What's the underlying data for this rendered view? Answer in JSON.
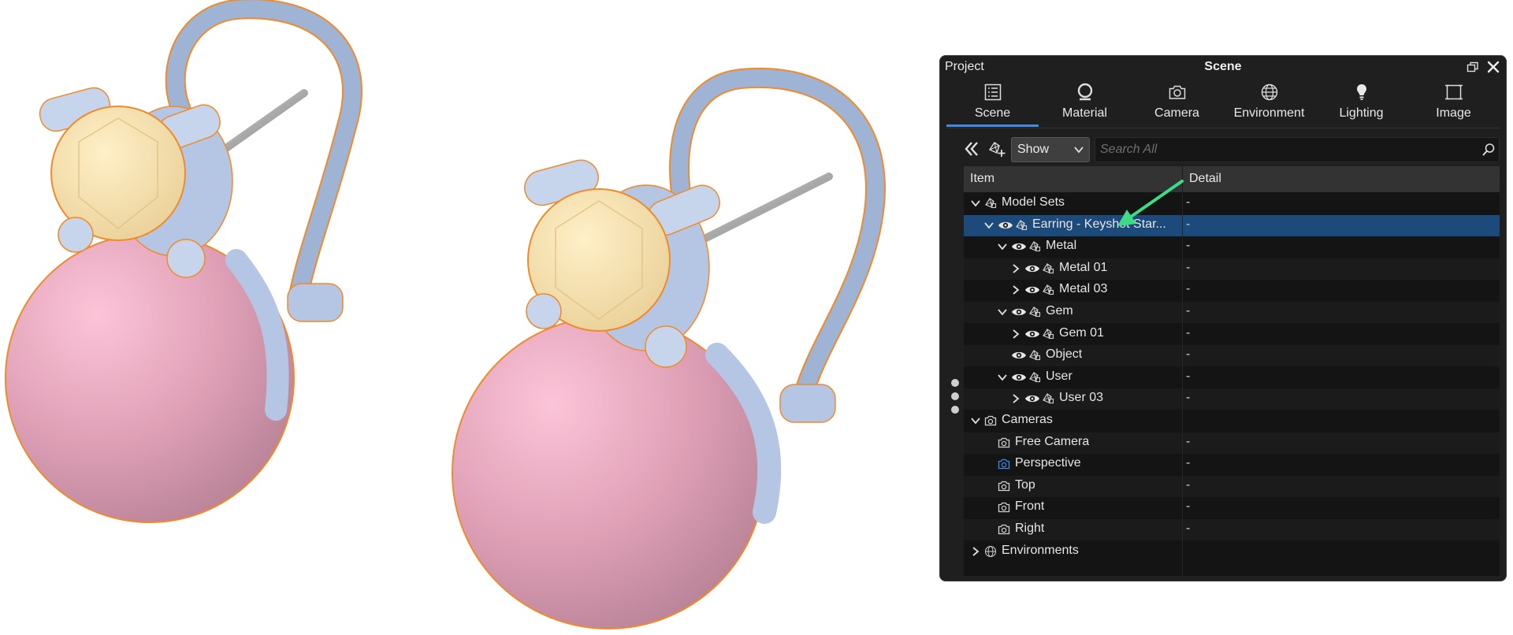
{
  "panel": {
    "project_label": "Project",
    "title": "Scene",
    "tabs": [
      {
        "label": "Scene",
        "icon": "list-icon",
        "active": true
      },
      {
        "label": "Material",
        "icon": "material-sphere-icon"
      },
      {
        "label": "Camera",
        "icon": "camera-icon"
      },
      {
        "label": "Environment",
        "icon": "globe-icon"
      },
      {
        "label": "Lighting",
        "icon": "lightbulb-icon"
      },
      {
        "label": "Image",
        "icon": "image-frame-icon"
      }
    ],
    "toolbar": {
      "filter_value": "Show",
      "search_placeholder": "Search All"
    },
    "columns": {
      "item": "Item",
      "detail": "Detail"
    },
    "rows": [
      {
        "label": "Model Sets",
        "detail": "-",
        "depth": 0,
        "expander": "open",
        "eye": false,
        "icon": "model-set-icon"
      },
      {
        "label": "Earring - Keyshot Star...",
        "detail": "-",
        "depth": 1,
        "expander": "open",
        "eye": true,
        "icon": "model-set-icon",
        "selected": true
      },
      {
        "label": "Metal",
        "detail": "-",
        "depth": 2,
        "expander": "open",
        "eye": true,
        "icon": "model-set-icon"
      },
      {
        "label": "Metal 01",
        "detail": "-",
        "depth": 3,
        "expander": "closed",
        "eye": true,
        "icon": "model-set-icon"
      },
      {
        "label": "Metal 03",
        "detail": "-",
        "depth": 3,
        "expander": "closed",
        "eye": true,
        "icon": "model-set-icon"
      },
      {
        "label": "Gem",
        "detail": "-",
        "depth": 2,
        "expander": "open",
        "eye": true,
        "icon": "model-set-icon"
      },
      {
        "label": "Gem 01",
        "detail": "-",
        "depth": 3,
        "expander": "closed",
        "eye": true,
        "icon": "model-set-icon"
      },
      {
        "label": "Object",
        "detail": "-",
        "depth": 2,
        "expander": "none",
        "eye": true,
        "icon": "model-set-icon"
      },
      {
        "label": "User",
        "detail": "-",
        "depth": 2,
        "expander": "open",
        "eye": true,
        "icon": "model-set-icon"
      },
      {
        "label": "User 03",
        "detail": "-",
        "depth": 3,
        "expander": "closed",
        "eye": true,
        "icon": "model-set-icon"
      },
      {
        "label": "Cameras",
        "detail": "",
        "depth": 0,
        "expander": "open",
        "eye": false,
        "icon": "camera-icon"
      },
      {
        "label": "Free Camera",
        "detail": "-",
        "depth": 1,
        "expander": "none",
        "eye": false,
        "icon": "camera-icon"
      },
      {
        "label": "Perspective",
        "detail": "-",
        "depth": 1,
        "expander": "none",
        "eye": false,
        "icon": "camera-icon",
        "active_camera": true
      },
      {
        "label": "Top",
        "detail": "-",
        "depth": 1,
        "expander": "none",
        "eye": false,
        "icon": "camera-icon"
      },
      {
        "label": "Front",
        "detail": "-",
        "depth": 1,
        "expander": "none",
        "eye": false,
        "icon": "camera-icon"
      },
      {
        "label": "Right",
        "detail": "-",
        "depth": 1,
        "expander": "none",
        "eye": false,
        "icon": "camera-icon"
      },
      {
        "label": "Environments",
        "detail": "",
        "depth": 0,
        "expander": "closed",
        "eye": false,
        "icon": "globe-icon"
      }
    ]
  },
  "colors": {
    "panel_bg": "#1f1f1f",
    "selection": "#1b4a7b",
    "accent": "#3d8be8",
    "annotation_arrow": "#3ddc84",
    "gem": "#f5dfae",
    "pearl": "#e3a7bd",
    "metal": "#b7c9e6",
    "outline": "#f08a2a"
  }
}
